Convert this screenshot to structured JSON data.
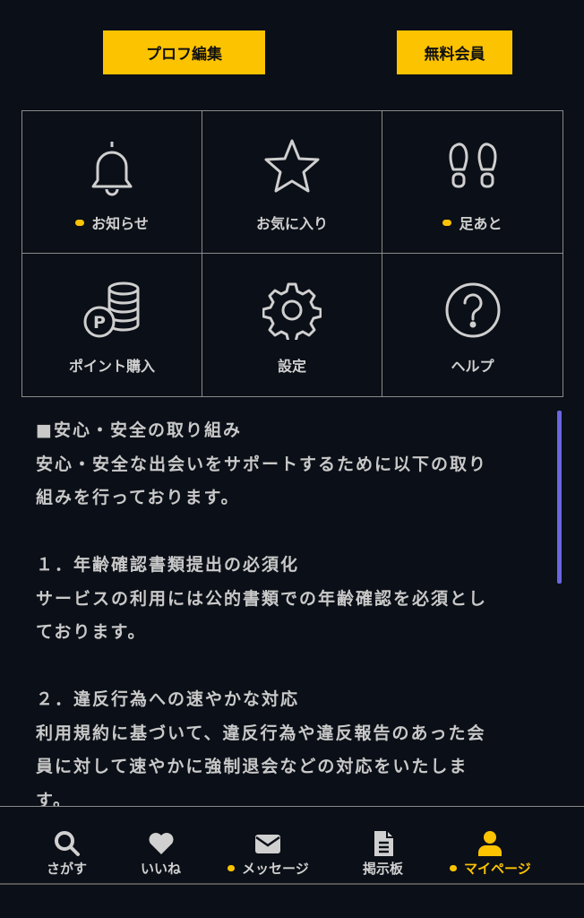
{
  "top_buttons": {
    "edit_profile": "プロフ編集",
    "membership": "無料会員"
  },
  "menu": [
    {
      "label": "お知らせ",
      "icon": "bell-icon",
      "dot": true
    },
    {
      "label": "お気に入り",
      "icon": "star-icon",
      "dot": false
    },
    {
      "label": "足あと",
      "icon": "footprints-icon",
      "dot": true
    },
    {
      "label": "ポイント購入",
      "icon": "coins-icon",
      "dot": false
    },
    {
      "label": "設定",
      "icon": "gear-icon",
      "dot": false
    },
    {
      "label": "ヘルプ",
      "icon": "help-icon",
      "dot": false
    }
  ],
  "info": {
    "heading": "■安心・安全の取り組み",
    "intro_1": "安心・安全な出会いをサポートするために以下の取り",
    "intro_2": "組みを行っております。",
    "item1_title": "１．年齢確認書類提出の必須化",
    "item1_body_1": "サービスの利用には公的書類での年齢確認を必須とし",
    "item1_body_2": "ております。",
    "item2_title": "２．違反行為への速やかな対応",
    "item2_body_1": "利用規約に基づいて、違反行為や違反報告のあった会",
    "item2_body_2": "員に対して速やかに強制退会などの対応をいたしま",
    "item2_body_3": "す。"
  },
  "nav": [
    {
      "label": "さがす",
      "icon": "search-icon",
      "dot": false,
      "active": false
    },
    {
      "label": "いいね",
      "icon": "heart-icon",
      "dot": false,
      "active": false
    },
    {
      "label": "メッセージ",
      "icon": "envelope-icon",
      "dot": true,
      "active": false
    },
    {
      "label": "掲示板",
      "icon": "document-icon",
      "dot": false,
      "active": false
    },
    {
      "label": "マイページ",
      "icon": "user-icon",
      "dot": true,
      "active": true
    }
  ],
  "colors": {
    "background": "#0b0f17",
    "accent": "#fcc300",
    "scrollbar": "#6a66e0"
  }
}
